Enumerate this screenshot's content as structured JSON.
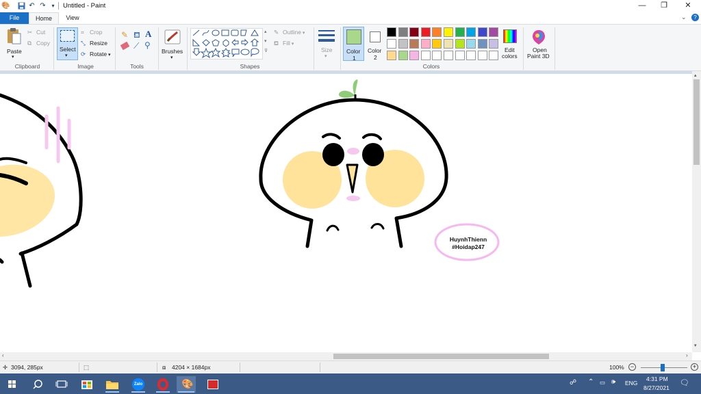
{
  "window": {
    "title": "Untitled - Paint"
  },
  "window_controls": {
    "minimize": "—",
    "restore": "❐",
    "close": "✕"
  },
  "tabs": [
    {
      "label": "File"
    },
    {
      "label": "Home"
    },
    {
      "label": "View"
    }
  ],
  "ribbon": {
    "clipboard": {
      "paste": "Paste",
      "cut": "Cut",
      "copy": "Copy",
      "label": "Clipboard"
    },
    "image": {
      "select": "Select",
      "crop": "Crop",
      "resize": "Resize",
      "rotate": "Rotate",
      "label": "Image"
    },
    "tools": {
      "label": "Tools"
    },
    "brushes": {
      "label": "Brushes"
    },
    "shapes": {
      "outline": "Outline",
      "fill": "Fill",
      "label": "Shapes"
    },
    "size": {
      "label": "Size"
    },
    "color1": {
      "label": "Color",
      "num": "1"
    },
    "color2": {
      "label": "Color",
      "num": "2"
    },
    "colors_label": "Colors",
    "edit_colors": {
      "line1": "Edit",
      "line2": "colors"
    },
    "open_paint3d": {
      "line1": "Open",
      "line2": "Paint 3D"
    },
    "palette_row1": [
      "#000000",
      "#7f7f7f",
      "#880015",
      "#ed1c24",
      "#ff7f27",
      "#fff200",
      "#22b14c",
      "#00a2e8",
      "#3f48cc",
      "#a349a4"
    ],
    "palette_row2": [
      "#ffffff",
      "#c3c3c3",
      "#b97a57",
      "#ffaec9",
      "#ffc90e",
      "#efe4b0",
      "#b5e61d",
      "#99d9ea",
      "#7092be",
      "#c8bfe7"
    ],
    "palette_row3": [
      "#ffd98c",
      "#a8d98a",
      "#f7b5e6",
      "#ffffff",
      "#ffffff",
      "#ffffff",
      "#ffffff",
      "#ffffff",
      "#ffffff",
      "#ffffff"
    ],
    "color1_value": "#a8d98a",
    "color2_value": "#ffffff"
  },
  "canvas": {
    "watermark_line1": "HuynhThienn",
    "watermark_line2": "#Hoidap247",
    "colors": {
      "blush": "#ffe39a",
      "sprout": "#8fcc77",
      "pink": "#f6c8ef",
      "ellipse": "#f5b8ef"
    }
  },
  "statusbar": {
    "cursor": "3094, 285px",
    "size": "4204 × 1684px",
    "zoom": "100%"
  },
  "taskbar": {
    "lang": "ENG",
    "time": "4:31 PM",
    "date": "8/27/2021",
    "apps": [
      "start-icon",
      "search-icon",
      "task-view-icon",
      "store-icon",
      "file-explorer-icon",
      "zalo-icon",
      "opera-icon",
      "paint-icon",
      "bluestacks-icon"
    ],
    "zalo_text": "Zalo"
  }
}
